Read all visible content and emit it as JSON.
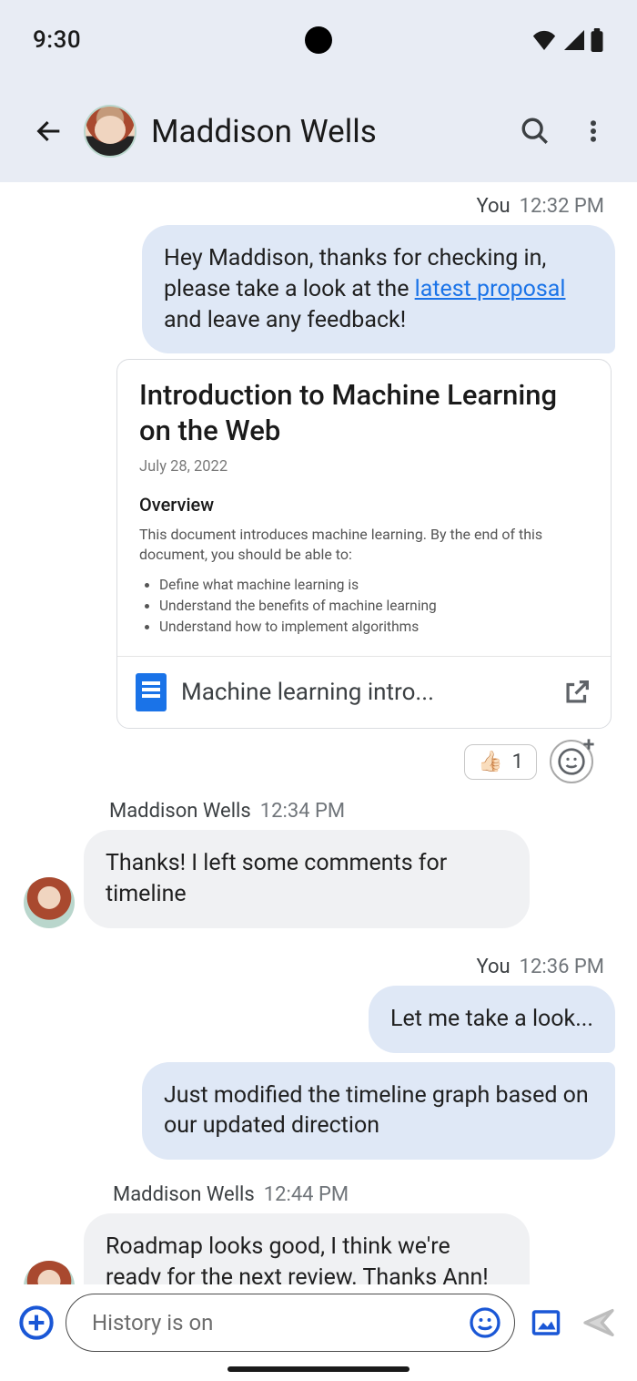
{
  "status": {
    "time": "9:30"
  },
  "header": {
    "title": "Maddison Wells"
  },
  "messages": {
    "m1": {
      "sender": "You",
      "time": "12:32 PM",
      "text_pre": "Hey Maddison, thanks for checking in, please take a look at the ",
      "link_text": "latest proposal",
      "text_post": " and leave any feedback!"
    },
    "card": {
      "title": "Introduction to Machine Learning on the Web",
      "date": "July 28, 2022",
      "h2": "Overview",
      "p": "This document introduces machine learning. By the end of this document, you should be able to:",
      "li1": "Define what machine learning is",
      "li2": "Understand the benefits of machine learning",
      "li3": "Understand how to implement algorithms",
      "file": "Machine learning intro..."
    },
    "reaction": {
      "emoji": "👍🏻",
      "count": "1"
    },
    "m2": {
      "sender": "Maddison Wells",
      "time": "12:34 PM",
      "text": "Thanks! I left some comments for timeline"
    },
    "m3": {
      "sender": "You",
      "time": "12:36 PM",
      "text1": "Let me take a look...",
      "text2": "Just modified the timeline graph based on our updated direction"
    },
    "m4": {
      "sender": "Maddison Wells",
      "time": "12:44 PM",
      "text": "Roadmap looks good, I think we're ready for the next review. Thanks Ann!"
    }
  },
  "composer": {
    "placeholder": "History is on"
  }
}
